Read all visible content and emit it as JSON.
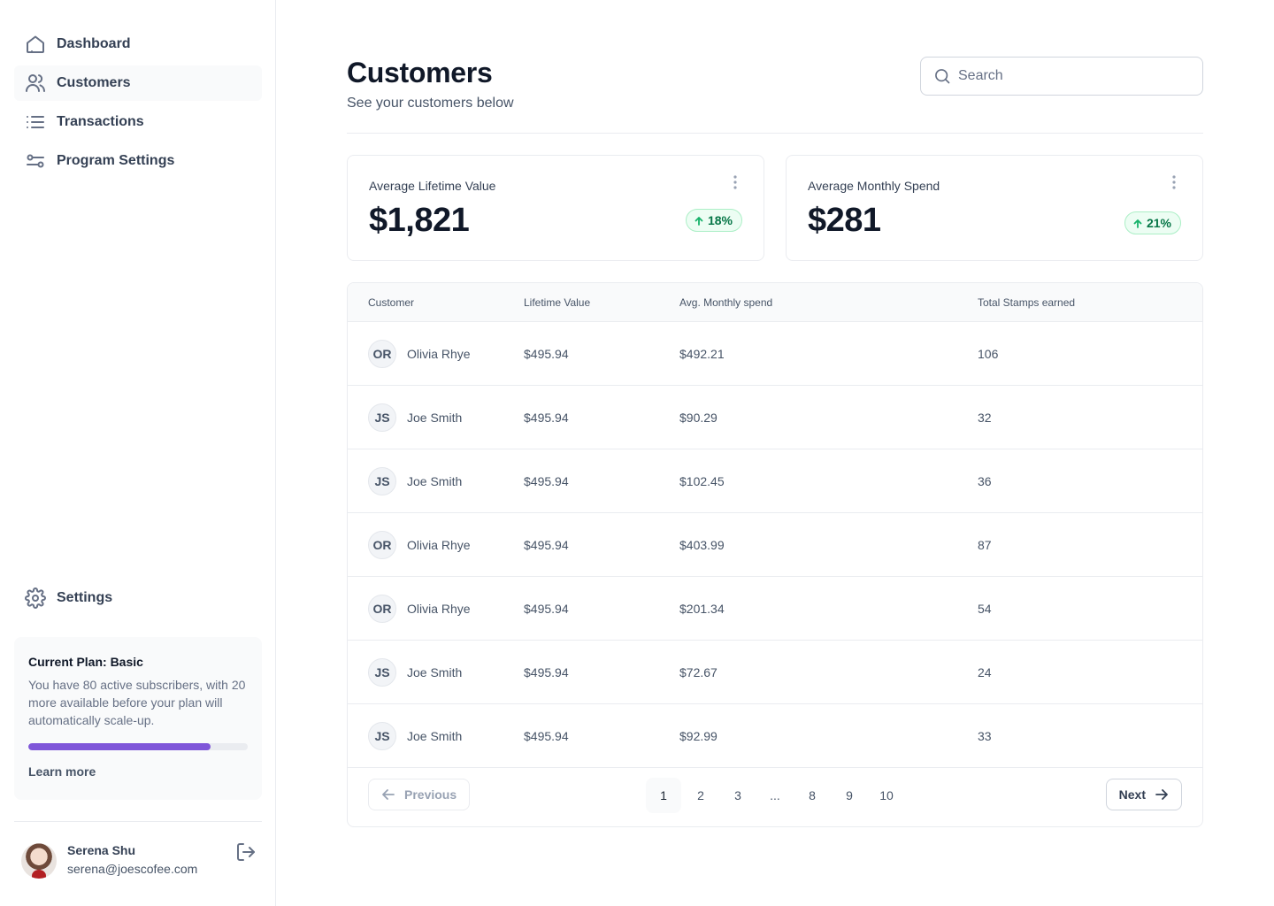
{
  "sidebar": {
    "nav": [
      {
        "label": "Dashboard",
        "icon": "home-icon"
      },
      {
        "label": "Customers",
        "icon": "users-icon"
      },
      {
        "label": "Transactions",
        "icon": "list-icon"
      },
      {
        "label": "Program Settings",
        "icon": "sliders-icon"
      }
    ],
    "settings_label": "Settings",
    "plan": {
      "title": "Current Plan: Basic",
      "text": "You have 80 active subscribers, with 20 more available before your plan will automatically scale-up.",
      "progress": 0.83,
      "link": "Learn more"
    },
    "account": {
      "name": "Serena Shu",
      "email": "serena@joescofee.com"
    }
  },
  "header": {
    "title": "Customers",
    "subtitle": "See your customers below",
    "search_placeholder": "Search"
  },
  "stats": [
    {
      "label": "Average Lifetime Value",
      "value": "$1,821",
      "change": "18%"
    },
    {
      "label": "Average Monthly Spend",
      "value": "$281",
      "change": "21%"
    }
  ],
  "table": {
    "headers": [
      "Customer",
      "Lifetime Value",
      "Avg. Monthly spend",
      "Total Stamps earned"
    ],
    "rows": [
      {
        "initials": "OR",
        "name": "Olivia Rhye",
        "lifetime": "$495.94",
        "monthly": "$492.21",
        "stamps": "106"
      },
      {
        "initials": "JS",
        "name": "Joe Smith",
        "lifetime": "$495.94",
        "monthly": "$90.29",
        "stamps": "32"
      },
      {
        "initials": "JS",
        "name": "Joe Smith",
        "lifetime": "$495.94",
        "monthly": "$102.45",
        "stamps": "36"
      },
      {
        "initials": "OR",
        "name": "Olivia Rhye",
        "lifetime": "$495.94",
        "monthly": "$403.99",
        "stamps": "87"
      },
      {
        "initials": "OR",
        "name": "Olivia Rhye",
        "lifetime": "$495.94",
        "monthly": "$201.34",
        "stamps": "54"
      },
      {
        "initials": "JS",
        "name": "Joe Smith",
        "lifetime": "$495.94",
        "monthly": "$72.67",
        "stamps": "24"
      },
      {
        "initials": "JS",
        "name": "Joe Smith",
        "lifetime": "$495.94",
        "monthly": "$92.99",
        "stamps": "33"
      }
    ]
  },
  "pagination": {
    "previous": "Previous",
    "next": "Next",
    "pages": [
      "1",
      "2",
      "3",
      "...",
      "8",
      "9",
      "10"
    ],
    "current": "1"
  },
  "colors": {
    "accent": "#7f56d9",
    "success": "#067647"
  }
}
